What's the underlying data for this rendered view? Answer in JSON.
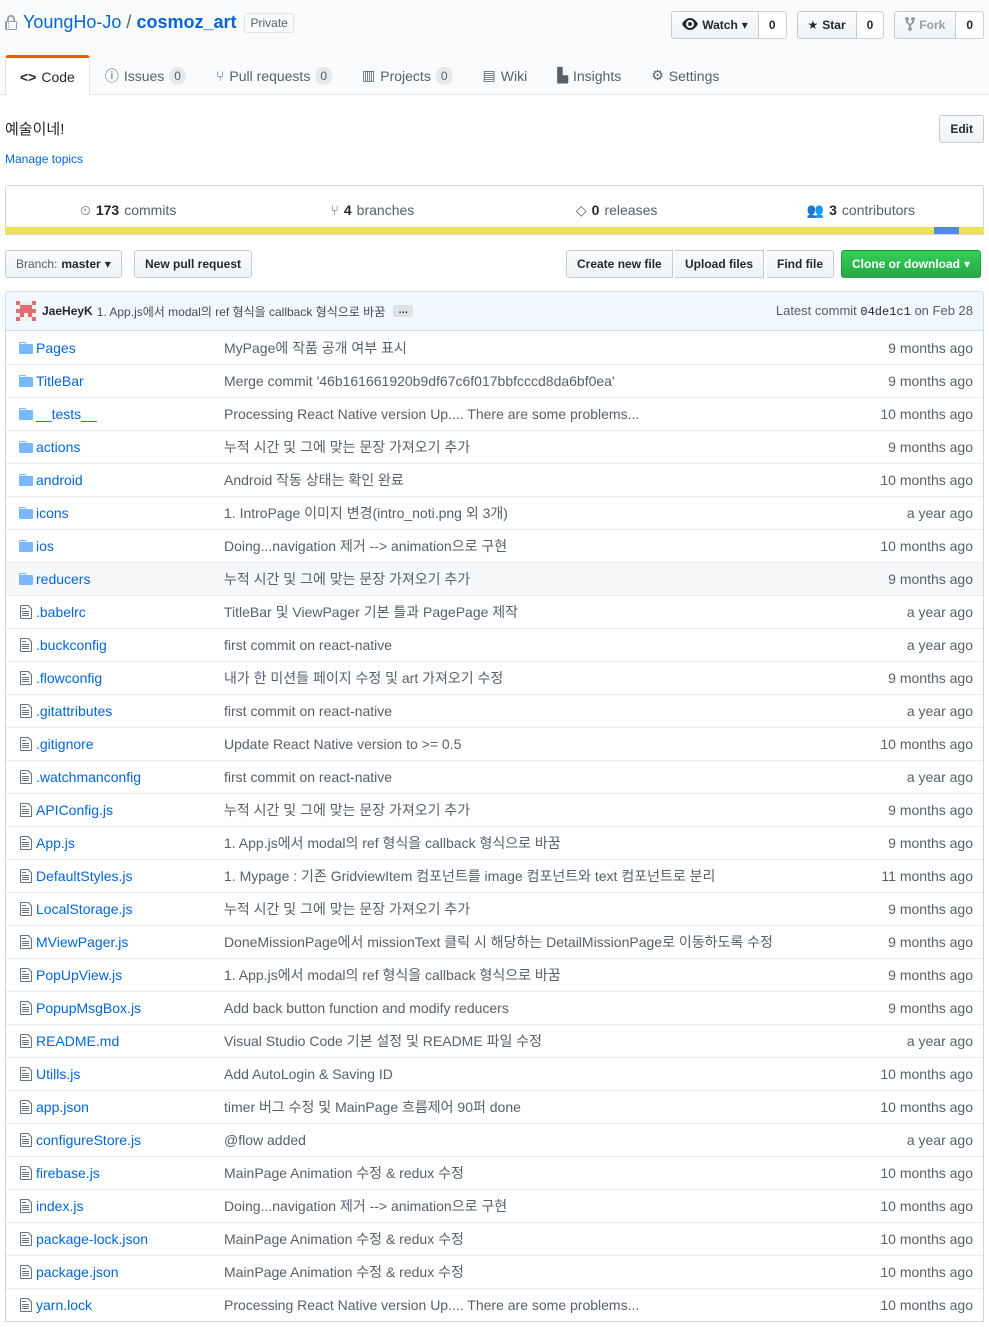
{
  "repo": {
    "owner": "YoungHo-Jo",
    "separator": "/",
    "name": "cosmoz_art",
    "visibility": "Private"
  },
  "header_actions": [
    {
      "label": "Watch",
      "count": "0"
    },
    {
      "label": "Star",
      "count": "0"
    },
    {
      "label": "Fork",
      "count": "0"
    }
  ],
  "tabs": [
    {
      "label": "Code"
    },
    {
      "label": "Issues",
      "count": "0"
    },
    {
      "label": "Pull requests",
      "count": "0"
    },
    {
      "label": "Projects",
      "count": "0"
    },
    {
      "label": "Wiki"
    },
    {
      "label": "Insights"
    },
    {
      "label": "Settings"
    }
  ],
  "description": "예술이네!",
  "manage_topics": "Manage topics",
  "edit_label": "Edit",
  "summary": {
    "commits": {
      "num": "173",
      "label": "commits"
    },
    "branches": {
      "num": "4",
      "label": "branches"
    },
    "releases": {
      "num": "0",
      "label": "releases"
    },
    "contributors": {
      "num": "3",
      "label": "contributors"
    }
  },
  "colors": {
    "lang_primary": "#f1e05a",
    "lang_secondary": "#4F8BE0",
    "clone_button": "#28a745",
    "link": "#0366d6",
    "active_tab": "#e36209"
  },
  "toolbar": {
    "branch_prefix": "Branch:",
    "branch": "master",
    "new_pr": "New pull request",
    "create_file": "Create new file",
    "upload": "Upload files",
    "find": "Find file",
    "clone": "Clone or download"
  },
  "latest_commit": {
    "author": "JaeHeyK",
    "message": "1. App.js에서 modal의 ref 형식을 callback 형식으로 바꿈",
    "ellipsis": "…",
    "prefix": "Latest commit",
    "sha": "04de1c1",
    "date": "on Feb 28"
  },
  "files": [
    {
      "type": "dir",
      "name": "Pages",
      "message": "MyPage에 작품 공개 여부 표시",
      "age": "9 months ago"
    },
    {
      "type": "dir",
      "name": "TitleBar",
      "message": "Merge commit '46b161661920b9df67c6f017bbfcccd8da6bf0ea'",
      "age": "9 months ago"
    },
    {
      "type": "dir",
      "name": "__tests__",
      "message": "Processing React Native version Up.... There are some problems...",
      "age": "10 months ago"
    },
    {
      "type": "dir",
      "name": "actions",
      "message": "누적 시간 및 그에 맞는 문장 가져오기 추가",
      "age": "9 months ago"
    },
    {
      "type": "dir",
      "name": "android",
      "message": "Android 작동 상태는 확인 완료",
      "age": "10 months ago"
    },
    {
      "type": "dir",
      "name": "icons",
      "message": "1. IntroPage 이미지 변경(intro_noti.png 외 3개)",
      "age": "a year ago"
    },
    {
      "type": "dir",
      "name": "ios",
      "message": "Doing...navigation 제거 --> animation으로 구현",
      "age": "10 months ago"
    },
    {
      "type": "dir",
      "name": "reducers",
      "message": "누적 시간 및 그에 맞는 문장 가져오기 추가",
      "age": "9 months ago"
    },
    {
      "type": "file",
      "name": ".babelrc",
      "message": "TitleBar 및 ViewPager 기본 틀과 PagePage 제작",
      "age": "a year ago"
    },
    {
      "type": "file",
      "name": ".buckconfig",
      "message": "first commit on react-native",
      "age": "a year ago"
    },
    {
      "type": "file",
      "name": ".flowconfig",
      "message": "내가 한 미션들 페이지 수정 및 art 가져오기 수정",
      "age": "9 months ago"
    },
    {
      "type": "file",
      "name": ".gitattributes",
      "message": "first commit on react-native",
      "age": "a year ago"
    },
    {
      "type": "file",
      "name": ".gitignore",
      "message": "Update React Native version to >= 0.5",
      "age": "10 months ago"
    },
    {
      "type": "file",
      "name": ".watchmanconfig",
      "message": "first commit on react-native",
      "age": "a year ago"
    },
    {
      "type": "file",
      "name": "APIConfig.js",
      "message": "누적 시간 및 그에 맞는 문장 가져오기 추가",
      "age": "9 months ago"
    },
    {
      "type": "file",
      "name": "App.js",
      "message": "1. App.js에서 modal의 ref 형식을 callback 형식으로 바꿈",
      "age": "9 months ago"
    },
    {
      "type": "file",
      "name": "DefaultStyles.js",
      "message": "1. Mypage : 기존 GridviewItem 컴포넌트를 image 컴포넌트와 text 컴포넌트로 분리",
      "age": "11 months ago"
    },
    {
      "type": "file",
      "name": "LocalStorage.js",
      "message": "누적 시간 및 그에 맞는 문장 가져오기 추가",
      "age": "9 months ago"
    },
    {
      "type": "file",
      "name": "MViewPager.js",
      "message": "DoneMissionPage에서 missionText 클릭 시 해당하는 DetailMissionPage로 이동하도록 수정",
      "age": "9 months ago"
    },
    {
      "type": "file",
      "name": "PopUpView.js",
      "message": "1. App.js에서 modal의 ref 형식을 callback 형식으로 바꿈",
      "age": "9 months ago"
    },
    {
      "type": "file",
      "name": "PopupMsgBox.js",
      "message": "Add back button function and modify reducers",
      "age": "9 months ago"
    },
    {
      "type": "file",
      "name": "README.md",
      "message": "Visual Studio Code 기본 설정 및 README 파일 수정",
      "age": "a year ago"
    },
    {
      "type": "file",
      "name": "Utills.js",
      "message": "Add AutoLogin & Saving ID",
      "age": "10 months ago"
    },
    {
      "type": "file",
      "name": "app.json",
      "message": "timer 버그 수정 및 MainPage 흐름제어 90퍼 done",
      "age": "10 months ago"
    },
    {
      "type": "file",
      "name": "configureStore.js",
      "message": "@flow added",
      "age": "a year ago"
    },
    {
      "type": "file",
      "name": "firebase.js",
      "message": "MainPage Animation 수정 & redux 수정",
      "age": "10 months ago"
    },
    {
      "type": "file",
      "name": "index.js",
      "message": "Doing...navigation 제거 --> animation으로 구현",
      "age": "10 months ago"
    },
    {
      "type": "file",
      "name": "package-lock.json",
      "message": "MainPage Animation 수정 & redux 수정",
      "age": "10 months ago"
    },
    {
      "type": "file",
      "name": "package.json",
      "message": "MainPage Animation 수정 & redux 수정",
      "age": "10 months ago"
    },
    {
      "type": "file",
      "name": "yarn.lock",
      "message": "Processing React Native version Up.... There are some problems...",
      "age": "10 months ago"
    }
  ]
}
